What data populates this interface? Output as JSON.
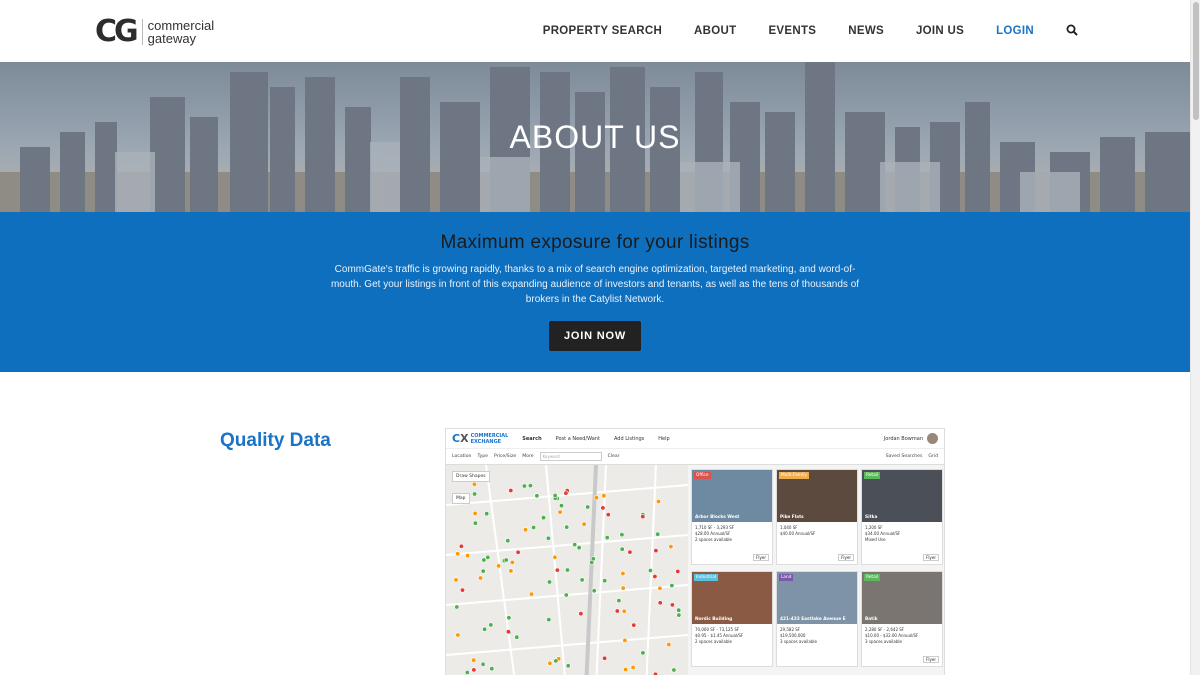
{
  "header": {
    "logo_mark": "CG",
    "logo_line1": "commercial",
    "logo_line2": "gateway",
    "nav": [
      "PROPERTY SEARCH",
      "ABOUT",
      "EVENTS",
      "NEWS",
      "JOIN US",
      "LOGIN"
    ]
  },
  "hero": {
    "title": "ABOUT US"
  },
  "banner": {
    "heading": "Maximum exposure for your listings",
    "body": "CommGate's traffic is growing rapidly, thanks to a mix of search engine optimization, targeted marketing, and word-of-mouth. Get your listings in front of this expanding audience of investors and tenants, as well as the tens of thousands of brokers in the Catylist Network.",
    "button": "JOIN NOW",
    "color": "#0f6fbf"
  },
  "section": {
    "title": "Quality Data"
  },
  "screenshot": {
    "brand_line1": "COMMERCIAL",
    "brand_line2": "EXCHANGE",
    "tabs": [
      "Search",
      "Post a Need/Want",
      "Add Listings",
      "Help"
    ],
    "user": "Jordan Bowman",
    "filters": [
      "Location",
      "Type",
      "Price/Size",
      "More"
    ],
    "keyword_placeholder": "Keyword",
    "clear": "Clear",
    "saved": "Saved Searches",
    "grid": "Grid",
    "draw_shapes": "Draw Shapes",
    "map_toggle": "Map",
    "cards": [
      {
        "tag": "Office",
        "tag_color": "#d9534f",
        "name": "Arbor Blocks West",
        "l1": "1,710 SF - 3,293 SF",
        "l2": "$28.00 Annual/SF",
        "l3": "2 spaces available"
      },
      {
        "tag": "Multi-Family",
        "tag_color": "#f0ad4e",
        "name": "Pike Flats",
        "l1": "1,040 SF",
        "l2": "$40.00 Annual/SF",
        "l3": ""
      },
      {
        "tag": "Retail",
        "tag_color": "#5cb85c",
        "name": "Sitka",
        "l1": "1,200 SF",
        "l2": "$34.00 Annual/SF",
        "l3": "Mixed Use"
      },
      {
        "tag": "Industrial",
        "tag_color": "#5bc0de",
        "name": "Nordic Building",
        "l1": "70,000 SF - 73,125 SF",
        "l2": "$0.95 - $1.45 Annual/SF",
        "l3": "2 spaces available"
      },
      {
        "tag": "Land",
        "tag_color": "#7a5aa8",
        "name": "421-433 Eastlake Avenue E",
        "l1": "29,582 SF",
        "l2": "$19,500,000",
        "l3": "3 spaces available"
      },
      {
        "tag": "Retail",
        "tag_color": "#5cb85c",
        "name": "Batik",
        "l1": "2,280 SF - 2,642 SF",
        "l2": "$10.00 - $32.00 Annual/SF",
        "l3": "3 spaces available"
      }
    ],
    "flyer": "Flyer"
  }
}
